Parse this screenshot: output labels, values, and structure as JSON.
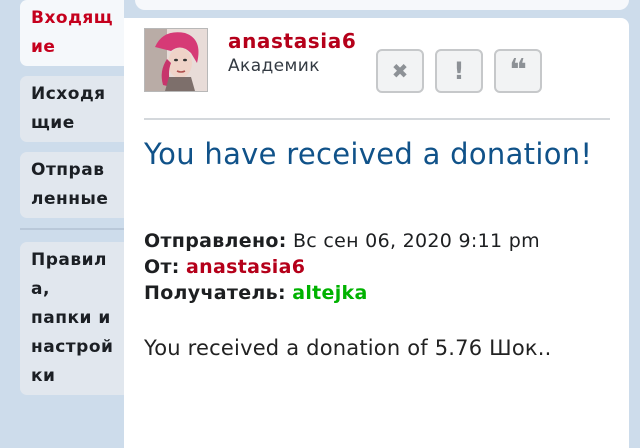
{
  "sidebar": {
    "items": [
      {
        "label": "Входящ\nие",
        "active": true
      },
      {
        "label": "Исходя\nщие",
        "active": false
      },
      {
        "label": "Отправ\nленные",
        "active": false
      },
      {
        "label": "Правил\nа,\nпапки и\nнастрой\nки",
        "active": false
      }
    ]
  },
  "post": {
    "username": "anastasia6",
    "rank": "Академик",
    "buttons": [
      {
        "icon": "close-icon",
        "glyph": "✖"
      },
      {
        "icon": "exclamation-icon",
        "glyph": "!"
      },
      {
        "icon": "quote-icon",
        "glyph": "❝"
      }
    ],
    "subject": "You have received a donation!",
    "sent_label": "Отправлено:",
    "sent_value": "Вс сен 06, 2020 9:11 pm",
    "from_label": "От:",
    "from_value": "anastasia6",
    "to_label": "Получатель:",
    "to_value": "altejka",
    "body": "You received a donation of 5.76 Шок.."
  },
  "colors": {
    "accent": "#105289",
    "author": "#b5001a",
    "recipient": "#00b200",
    "background": "#cddceb"
  }
}
